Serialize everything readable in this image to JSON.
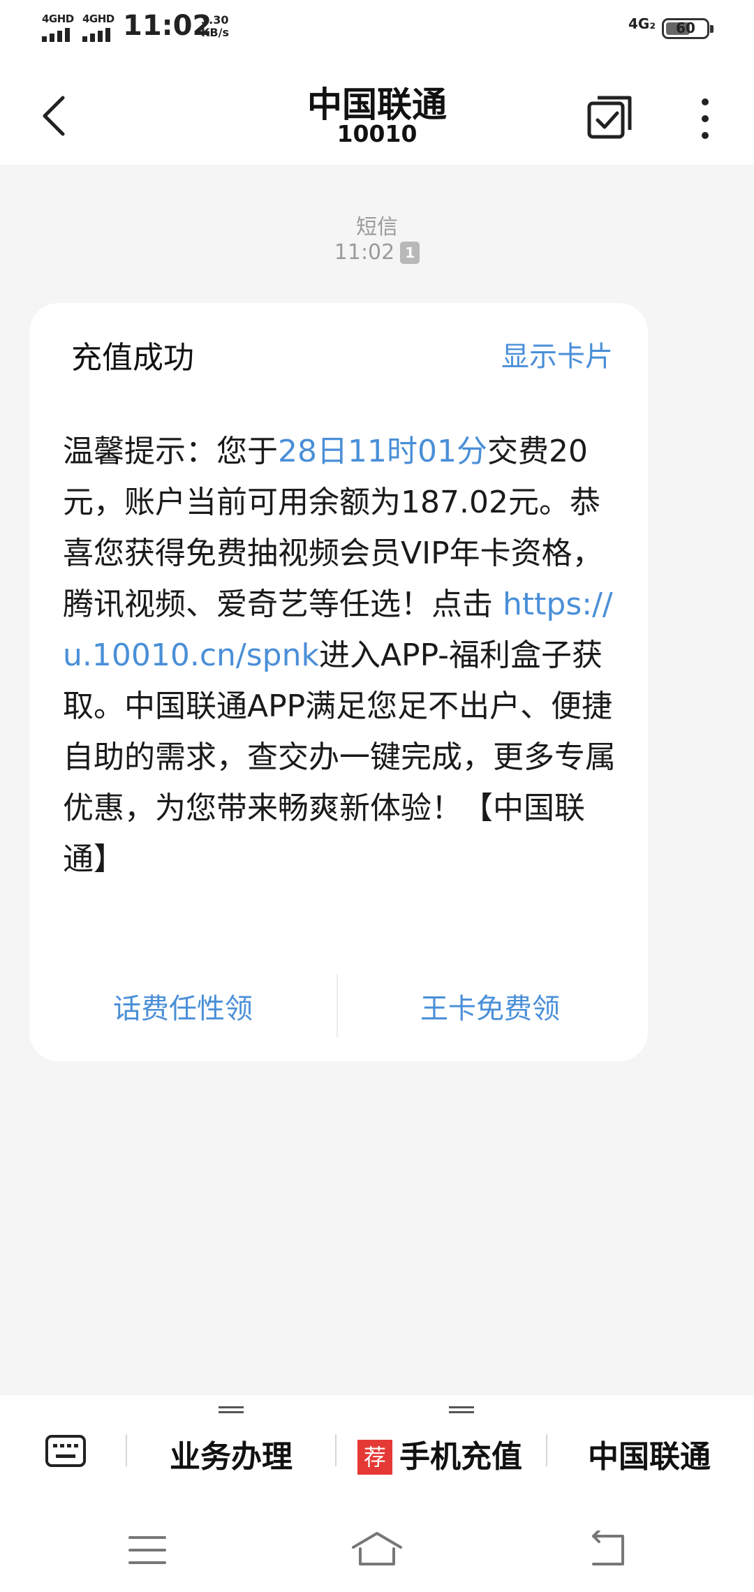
{
  "status_bar": {
    "sim1_network": "4GHD",
    "sim2_network": "4GHD",
    "time": "11:02",
    "speed_value": "3.30",
    "speed_unit": "KB/s",
    "network_right": "4G₂",
    "battery_level": 60,
    "battery_text": "60"
  },
  "header": {
    "contact_name": "中国联通",
    "contact_number": "10010"
  },
  "message": {
    "type_label": "短信",
    "time": "11:02",
    "sim_badge": "1",
    "card": {
      "title": "充值成功",
      "show_card_label": "显示卡片",
      "text_part1": "温馨提示：您于",
      "highlight_time": "28日11时01分",
      "text_part2": "交费20元，账户当前可用余额为187.02元。恭喜您获得免费抽视频会员VIP年卡资格，腾讯视频、爱奇艺等任选！点击 ",
      "link": "https://u.10010.cn/spnk",
      "text_part3": "进入APP-福利盒子获取。中国联通APP满足您足不出户、便捷自助的需求，查交办一键完成，更多专属优惠，为您带来畅爽新体验！【中国联通】",
      "action_left": "话费任性领",
      "action_right": "王卡免费领"
    }
  },
  "bottom_menu": {
    "item1": "业务办理",
    "item2_tag": "荐",
    "item2": "手机充值",
    "item3": "中国联通"
  },
  "colors": {
    "accent": "#4a8fd8",
    "background": "#f5f5f5",
    "card": "#ffffff",
    "tag_red": "#e53935"
  },
  "icons": {
    "back": "chevron-left-icon",
    "select": "checkbox-icon",
    "more": "more-vertical-icon",
    "keyboard": "keyboard-icon",
    "nav_menu": "menu-icon",
    "nav_home": "home-icon",
    "nav_back": "back-icon"
  }
}
